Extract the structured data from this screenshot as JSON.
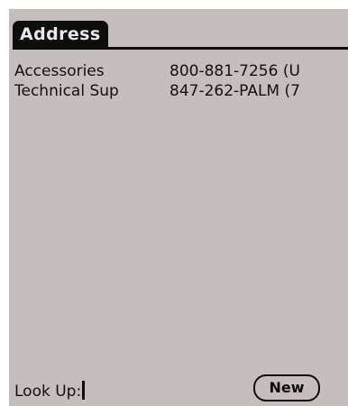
{
  "app": {
    "title": "Address"
  },
  "entries": [
    {
      "name": "Accessories",
      "phone": "800-881-7256 (U"
    },
    {
      "name": "Technical Sup",
      "phone": "847-262-PALM (7"
    }
  ],
  "lookup": {
    "label": "Look Up:",
    "value": ""
  },
  "buttons": {
    "new_label": "New"
  }
}
